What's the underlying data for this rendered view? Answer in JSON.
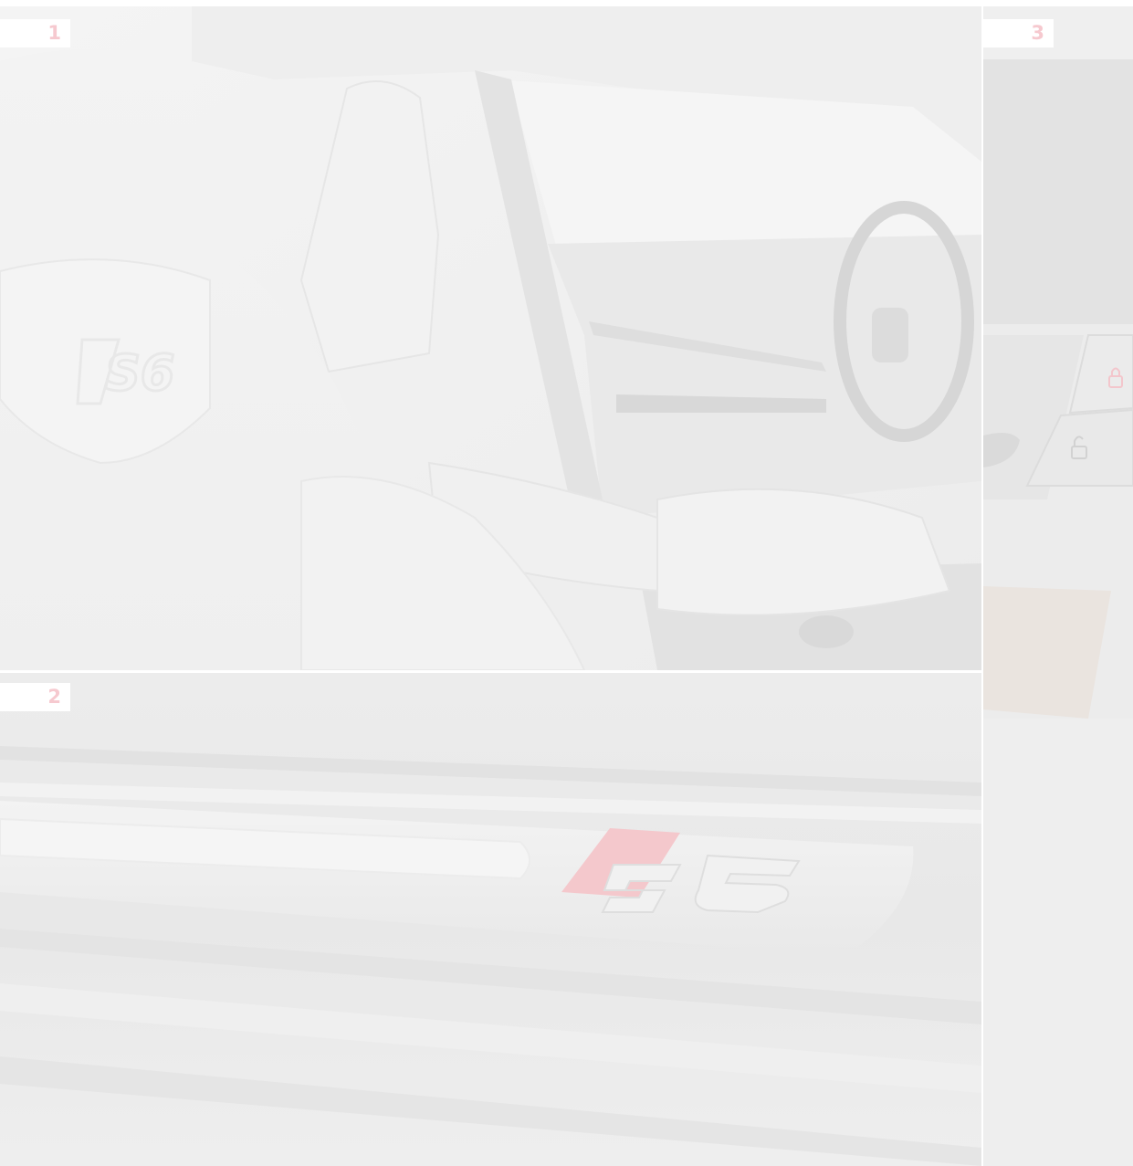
{
  "panels": [
    {
      "number": "1",
      "subject": "seat-interior-photo"
    },
    {
      "number": "2",
      "subject": "door-sill-photo"
    },
    {
      "number": "3",
      "subject": "door-lock-buttons-photo"
    }
  ],
  "colors": {
    "label_text": "#f6c9cf",
    "label_bg": "#ffffff",
    "accent_red": "#f4c8cc",
    "panel_light": "#f1f1f1",
    "panel_mid": "#ebebeb"
  }
}
